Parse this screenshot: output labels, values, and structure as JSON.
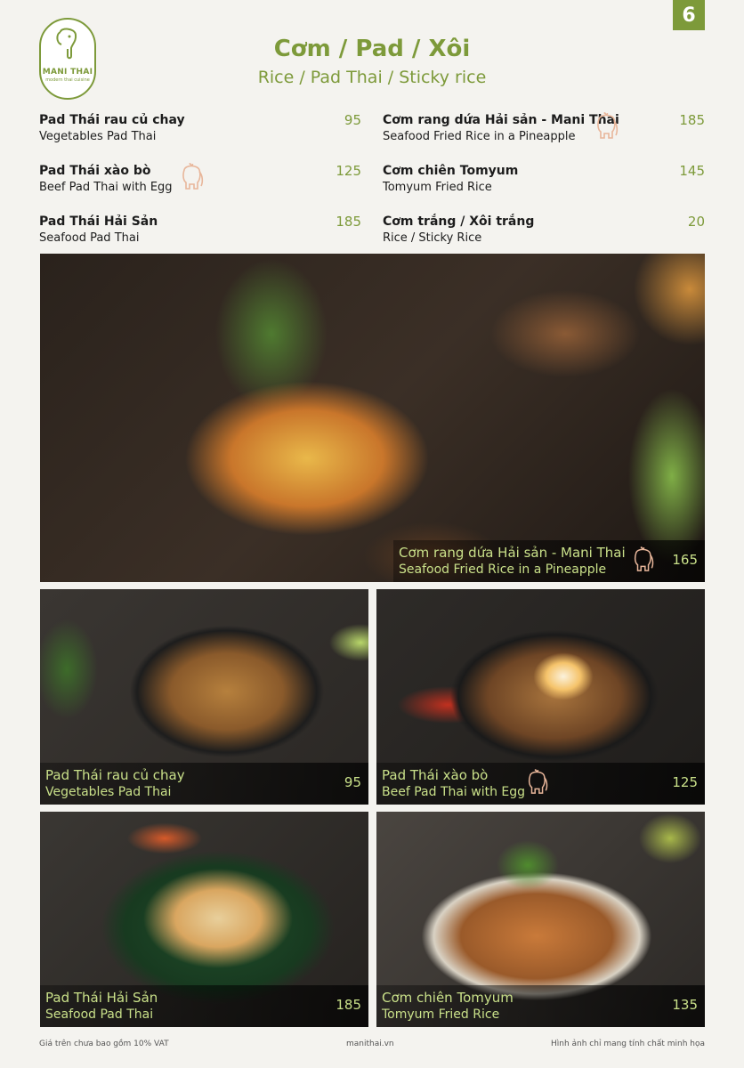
{
  "page_number": "6",
  "logo": {
    "brand": "MANI THAI",
    "tagline": "modern thai cuisine"
  },
  "header": {
    "title": "Cơm / Pad / Xôi",
    "subtitle": "Rice / Pad Thai / Sticky rice"
  },
  "menu_left": [
    {
      "name": "Pad Thái rau củ chay",
      "en": "Vegetables Pad Thai",
      "price": "95",
      "signature": false
    },
    {
      "name": "Pad Thái xào bò",
      "en": "Beef Pad Thai with Egg",
      "price": "125",
      "signature": true
    },
    {
      "name": "Pad Thái Hải Sản",
      "en": "Seafood Pad Thai",
      "price": "185",
      "signature": false
    }
  ],
  "menu_right": [
    {
      "name": "Cơm rang dứa Hải sản - Mani Thai",
      "en": "Seafood Fried Rice in a Pineapple",
      "price": "185",
      "signature": true
    },
    {
      "name": "Cơm chiên Tomyum",
      "en": "Tomyum Fried Rice",
      "price": "145",
      "signature": false
    },
    {
      "name": "Cơm trắng / Xôi trắng",
      "en": "Rice / Sticky Rice",
      "price": "20",
      "signature": false
    }
  ],
  "photos": {
    "main": {
      "name": "Cơm rang dứa Hải sản - Mani Thai",
      "en": "Seafood Fried Rice in a Pineapple",
      "price": "165"
    },
    "veg": {
      "name": "Pad Thái rau củ chay",
      "en": "Vegetables Pad Thai",
      "price": "95"
    },
    "beef": {
      "name": "Pad Thái xào bò",
      "en": "Beef Pad Thai with Egg",
      "price": "125"
    },
    "seafood": {
      "name": "Pad Thái Hải Sản",
      "en": "Seafood Pad Thai",
      "price": "185"
    },
    "tomyum": {
      "name": "Cơm chiên Tomyum",
      "en": "Tomyum Fried Rice",
      "price": "135"
    }
  },
  "footer": {
    "left": "Giá trên chưa bao gồm 10% VAT",
    "center": "manithai.vn",
    "right": "Hình ảnh chỉ mang tính chất minh họa"
  },
  "colors": {
    "accent": "#7d9a3a",
    "caption_text": "#c9e089",
    "badge": "#e8b69a"
  },
  "icons": {
    "signature": "elephant-icon"
  }
}
